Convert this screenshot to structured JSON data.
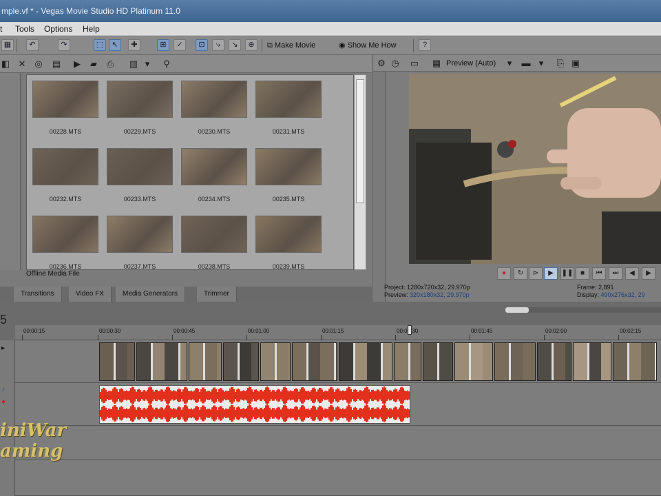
{
  "app": {
    "title": "mple.vf * - Vegas Movie Studio HD Platinum 11.0"
  },
  "menu": {
    "items": [
      "t",
      "Tools",
      "Options",
      "Help"
    ]
  },
  "toolbar": {
    "make_movie": "Make Movie",
    "show_me_how": "Show Me How"
  },
  "media": {
    "thumbnails": [
      {
        "name": "00228.MTS",
        "color": "#8a7a66"
      },
      {
        "name": "00229.MTS",
        "color": "#7a6e61"
      },
      {
        "name": "00230.MTS",
        "color": "#8c7c68"
      },
      {
        "name": "00231.MTS",
        "color": "#7f735f"
      },
      {
        "name": "00232.MTS",
        "color": "#6e6356"
      },
      {
        "name": "00233.MTS",
        "color": "#6a5f53"
      },
      {
        "name": "00234.MTS",
        "color": "#917f6a"
      },
      {
        "name": "00235.MTS",
        "color": "#8b7a65"
      },
      {
        "name": "00236.MTS",
        "color": "#857462"
      },
      {
        "name": "00237.MTS",
        "color": "#8d7c67"
      },
      {
        "name": "00238.MTS",
        "color": "#706456"
      },
      {
        "name": "00239.MTS",
        "color": "#877660"
      }
    ],
    "status": "Offline Media File",
    "tabs": [
      "Transitions",
      "Video FX",
      "Media Generators",
      "Trimmer"
    ]
  },
  "preview": {
    "mode": "Preview (Auto)",
    "project_label": "Project:",
    "project_value": "1280x720x32, 29.970p",
    "preview_label": "Preview:",
    "preview_value": "320x180x32, 29.970p",
    "frame_label": "Frame:",
    "frame_value": "2,891",
    "display_label": "Display:",
    "display_value": "490x276x32, 29"
  },
  "timeline": {
    "time_display": "5",
    "markers": [
      "00:00:15",
      "00:00:30",
      "00:00:45",
      "00:01:00",
      "00:01:15",
      "00:01:30",
      "00:01:45",
      "00:02:00",
      "00:02:15"
    ],
    "watermark_line1": "iniWar",
    "watermark_line2": "aming",
    "audio_color": "#e3301d"
  }
}
